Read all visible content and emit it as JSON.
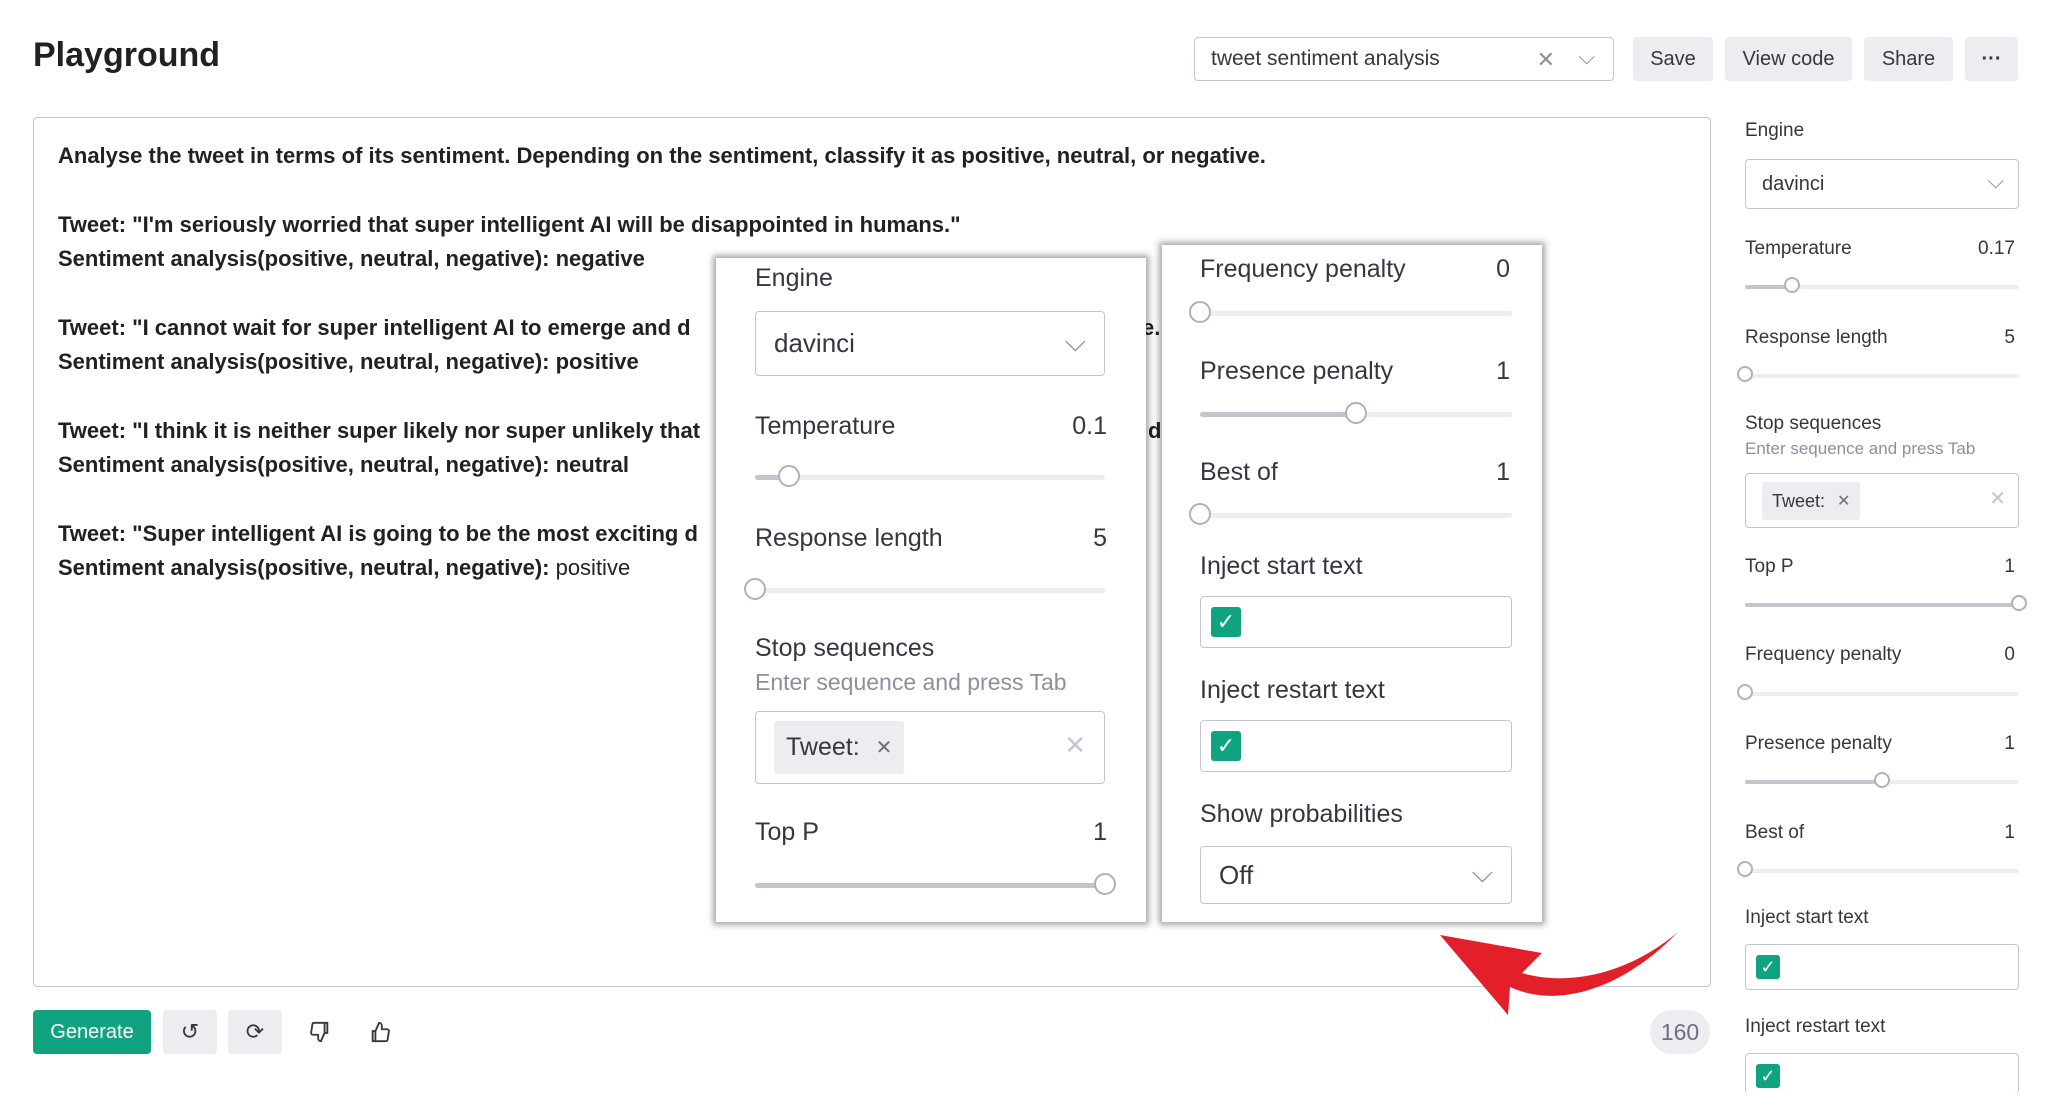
{
  "header": {
    "title": "Playground",
    "preset_value": "tweet sentiment analysis",
    "buttons": {
      "save": "Save",
      "view_code": "View code",
      "share": "Share",
      "more": "···"
    }
  },
  "prompt": {
    "instruction": "Analyse the tweet in terms of its sentiment. Depending on the sentiment, classify it as positive, neutral, or negative.",
    "examples": [
      {
        "tweet": "Tweet: \"I'm seriously worried that super intelligent AI will be disappointed in humans.\"",
        "label": "Sentiment analysis(positive, neutral, negative):",
        "answer": " negative"
      },
      {
        "tweet": "Tweet: \"I cannot wait for super intelligent AI to emerge and d",
        "tweet_tail": "e.",
        "label": "Sentiment analysis(positive, neutral, negative):",
        "answer": " positive"
      },
      {
        "tweet": "Tweet: \"I think it is neither super likely nor super unlikely that",
        "tweet_tail": "d",
        "label": "Sentiment analysis(positive, neutral, negative):",
        "answer": " neutral"
      },
      {
        "tweet": "Tweet: \"Super intelligent AI is going to be the most exciting d",
        "label": "Sentiment analysis(positive, neutral, negative):",
        "answer": " positive"
      }
    ]
  },
  "footer": {
    "generate": "Generate",
    "token_count": "160"
  },
  "sidebar": {
    "engine_label": "Engine",
    "engine_value": "davinci",
    "temperature_label": "Temperature",
    "temperature_value": "0.17",
    "response_length_label": "Response length",
    "response_length_value": "5",
    "stop_label": "Stop sequences",
    "stop_hint": "Enter sequence and press Tab",
    "stop_tag": "Tweet:",
    "top_p_label": "Top P",
    "top_p_value": "1",
    "frequency_label": "Frequency penalty",
    "frequency_value": "0",
    "presence_label": "Presence penalty",
    "presence_value": "1",
    "best_of_label": "Best of",
    "best_of_value": "1",
    "inject_start_label": "Inject start text",
    "inject_restart_label": "Inject restart text"
  },
  "zoom_left": {
    "engine_label": "Engine",
    "engine_value": "davinci",
    "temperature_label": "Temperature",
    "temperature_value": "0.1",
    "response_length_label": "Response length",
    "response_length_value": "5",
    "stop_label": "Stop sequences",
    "stop_hint": "Enter sequence and press Tab",
    "stop_tag": "Tweet:",
    "top_p_label": "Top P",
    "top_p_value": "1"
  },
  "zoom_right": {
    "frequency_label": "Frequency penalty",
    "frequency_value": "0",
    "presence_label": "Presence penalty",
    "presence_value": "1",
    "best_of_label": "Best of",
    "best_of_value": "1",
    "inject_start_label": "Inject start text",
    "inject_restart_label": "Inject restart text",
    "show_prob_label": "Show probabilities",
    "show_prob_value": "Off"
  },
  "colors": {
    "accent": "#10a37f",
    "arrow": "#e3202a"
  }
}
